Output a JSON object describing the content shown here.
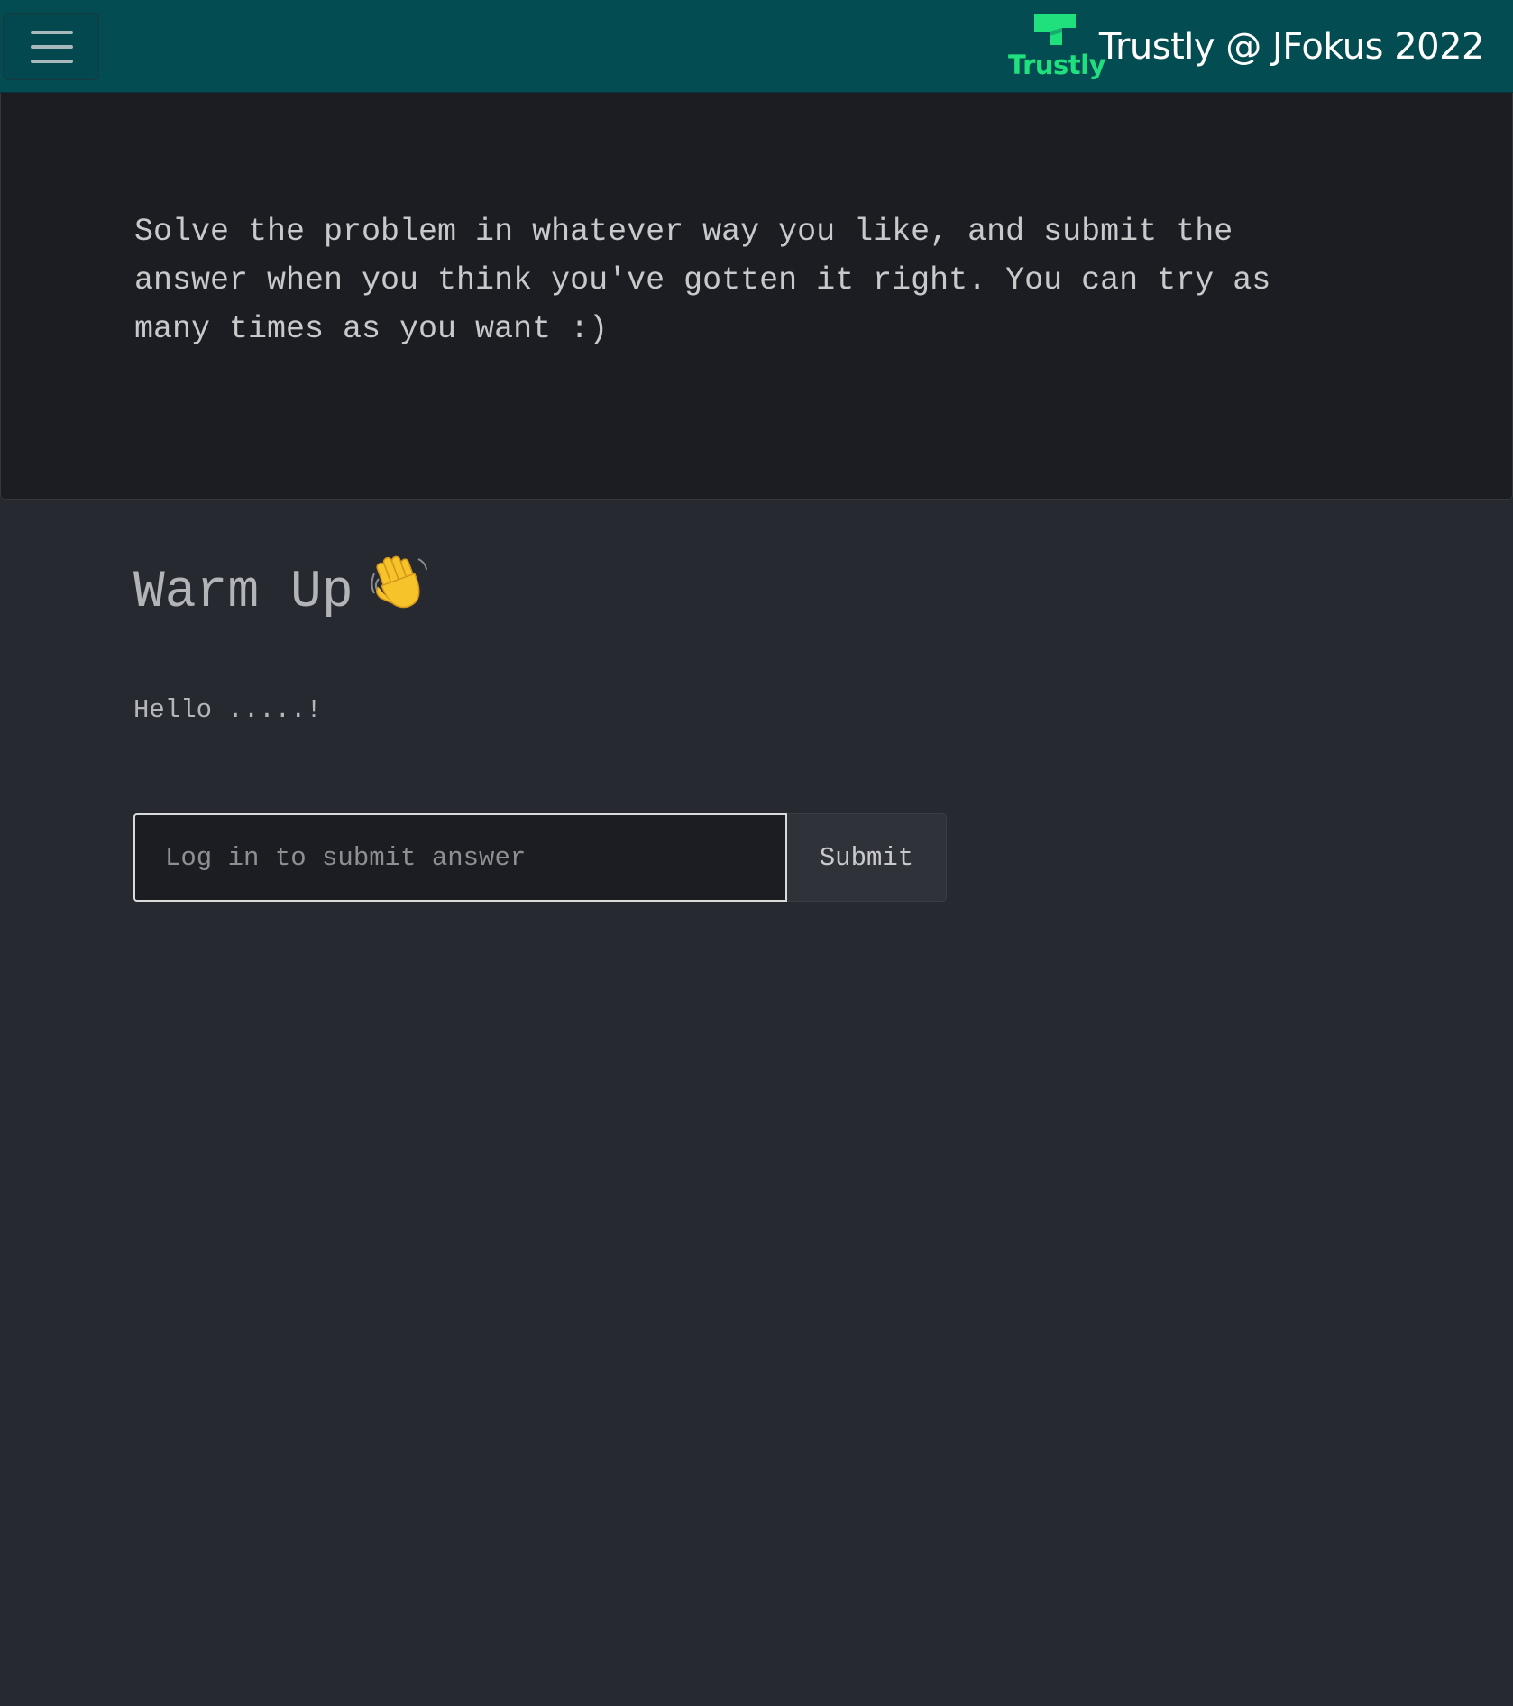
{
  "navbar": {
    "menu_toggle": "hamburger-menu-icon",
    "logo_text": "Trustly",
    "title": "Trustly @ JFokus 2022",
    "background": "#024c52",
    "accent": "#1fe07c"
  },
  "intro": {
    "text": "Solve the problem in whatever way you like, and submit the answer when you think you've gotten it right. You can try as many times as you want :)"
  },
  "problem": {
    "title": "Warm Up",
    "title_icon": "waving-hand-icon",
    "body": "Hello .....!"
  },
  "answer_form": {
    "placeholder": "Log in to submit answer",
    "submit_label": "Submit"
  }
}
